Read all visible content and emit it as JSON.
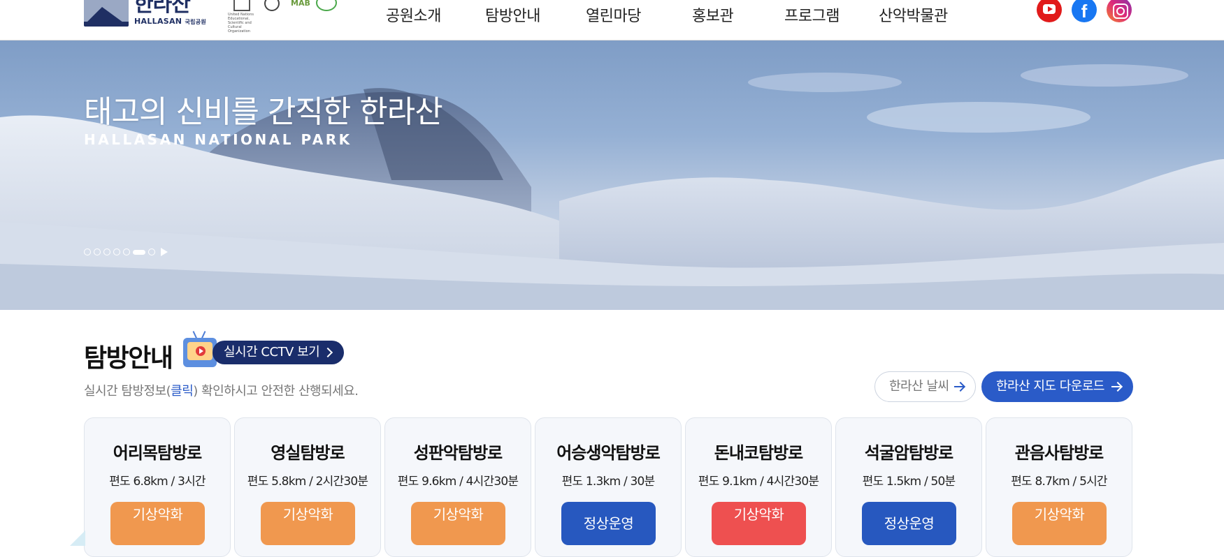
{
  "header": {
    "logo_ko": "한라산",
    "logo_en": "HALLASAN",
    "logo_en_small": "국립공원",
    "org_unesco": "United Nations Educational, Scientific and Cultural Organization",
    "org_mab": "MAB",
    "nav": [
      "공원소개",
      "탐방안내",
      "열린마당",
      "홍보관",
      "프로그램",
      "산악박물관"
    ],
    "social": [
      "youtube-icon",
      "facebook-icon",
      "instagram-icon"
    ]
  },
  "hero": {
    "title": "태고의 신비를 간직한 한라산",
    "subtitle": "HALLASAN NATIONAL PARK",
    "slide_count": 7,
    "active_slide": 6
  },
  "section": {
    "title": "탐방안내",
    "cctv_label": "실시간 CCTV 보기",
    "desc_before": "실시간 탐방정보(",
    "desc_link": "클릭",
    "desc_after": ") 확인하시고 안전한 산행되세요.",
    "weather_label": "한라산 날씨",
    "map_label": "한라산 지도 다운로드"
  },
  "trails": [
    {
      "name": "어리목탐방로",
      "info": "편도 6.8km / 3시간",
      "status": "기상악화",
      "status_color": "#f0984f"
    },
    {
      "name": "영실탐방로",
      "info": "편도 5.8km / 2시간30분",
      "status": "기상악화",
      "status_color": "#f0984f"
    },
    {
      "name": "성판악탐방로",
      "info": "편도 9.6km / 4시간30분",
      "status": "기상악화",
      "status_color": "#f0984f"
    },
    {
      "name": "어승생악탐방로",
      "info": "편도 1.3km / 30분",
      "status": "정상운영",
      "status_color": "#2758bf"
    },
    {
      "name": "돈내코탐방로",
      "info": "편도 9.1km / 4시간30분",
      "status": "기상악화",
      "status_color": "#ee5050"
    },
    {
      "name": "석굴암탐방로",
      "info": "편도 1.5km / 50분",
      "status": "정상운영",
      "status_color": "#2758bf"
    },
    {
      "name": "관음사탐방로",
      "info": "편도 8.7km / 5시간",
      "status": "기상악화",
      "status_color": "#f0984f"
    }
  ]
}
